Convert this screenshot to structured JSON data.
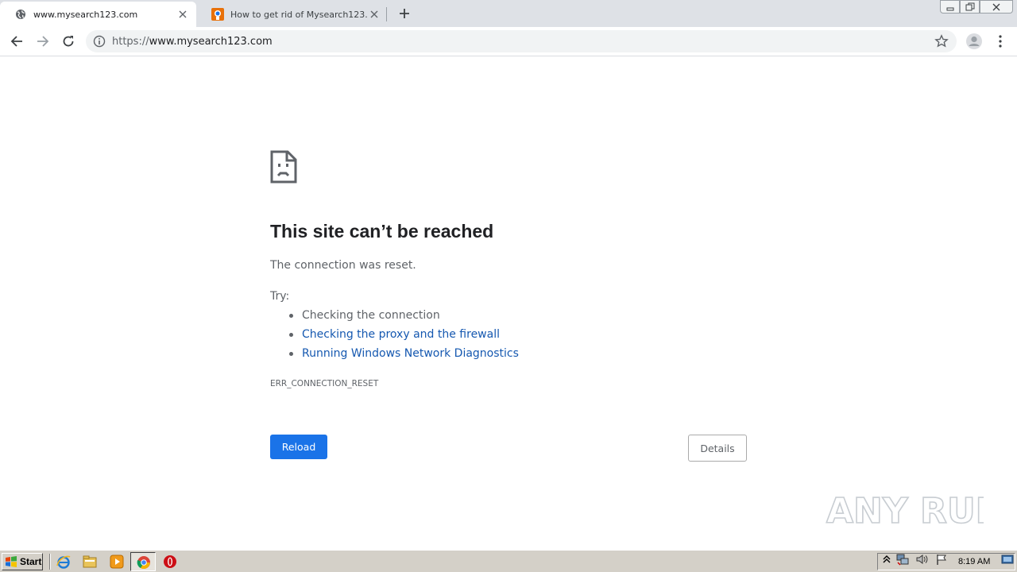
{
  "browser": {
    "tabs": [
      {
        "title": "www.mysearch123.com",
        "active": true,
        "favicon": "globe-icon"
      },
      {
        "title": "How to get rid of Mysearch123.com",
        "active": false,
        "favicon": "site-favicon-icon"
      }
    ],
    "omnibox": {
      "scheme": "https://",
      "host": "www.mysearch123.com"
    },
    "colors": {
      "tabstrip": "#dee1e6",
      "omnibox": "#f1f3f4"
    }
  },
  "page": {
    "heading": "This site can’t be reached",
    "subtitle": "The connection was reset.",
    "try_label": "Try:",
    "suggestions": [
      {
        "text": "Checking the connection",
        "link": false
      },
      {
        "text": "Checking the proxy and the firewall",
        "link": true
      },
      {
        "text": "Running Windows Network Diagnostics",
        "link": true
      }
    ],
    "error_code": "ERR_CONNECTION_RESET",
    "buttons": {
      "reload": "Reload",
      "details": "Details"
    },
    "colors": {
      "primary": "#1a73e8",
      "link": "#1558b0",
      "text": "#5f6368"
    }
  },
  "watermark": {
    "text": "ANY RUN"
  },
  "taskbar": {
    "start_label": "Start",
    "quick_launch": [
      "internet-explorer-icon",
      "file-explorer-icon",
      "media-player-icon",
      "chrome-icon",
      "opera-icon"
    ],
    "tray_icons": [
      "show-hidden-icons-icon",
      "network-icon",
      "volume-icon",
      "action-center-flag-icon",
      "show-desktop-icon"
    ],
    "clock": "8:19 AM"
  }
}
